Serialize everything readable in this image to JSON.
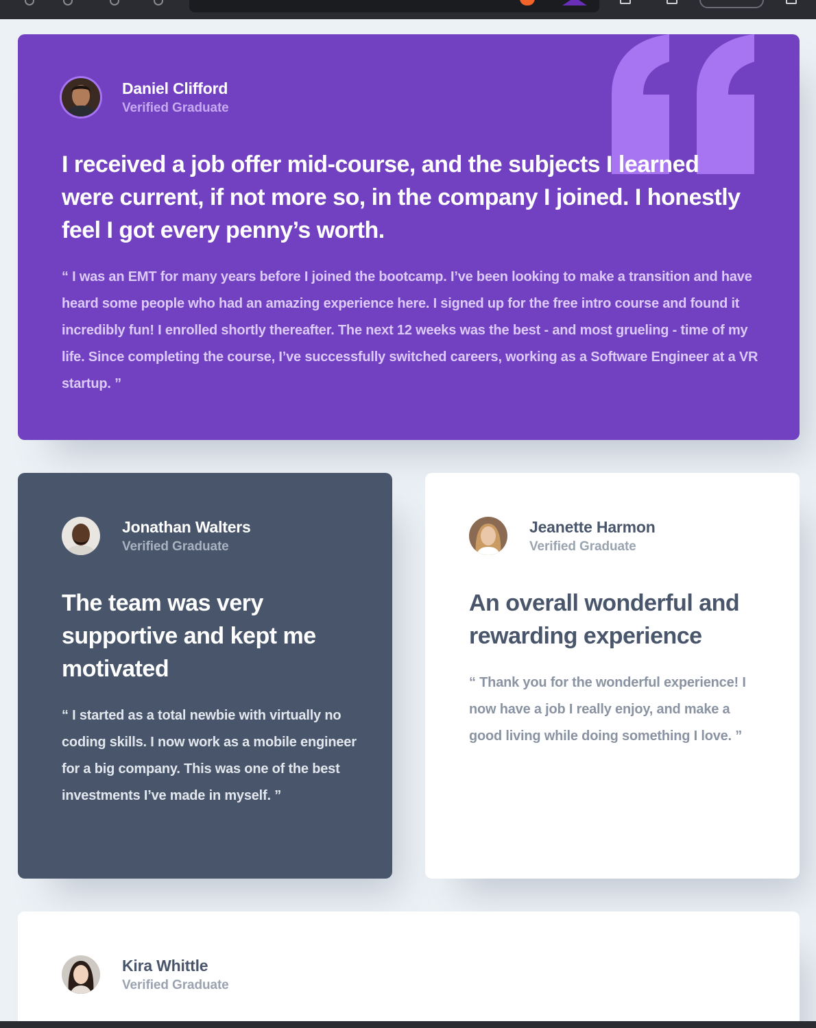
{
  "colors": {
    "purple": "#7241c1",
    "dark_blue": "#48556a",
    "white": "#ffffff",
    "page_bg": "#ecf1f6"
  },
  "testimonials": [
    {
      "name": "Daniel Clifford",
      "role": "Verified Graduate",
      "headline": "I received a job offer mid-course, and the subjects I learned were current, if not more so, in the company I joined. I honestly feel I got every penny’s worth.",
      "body": "“ I was an EMT for many years before I joined the bootcamp. I’ve been looking to make a transition and have heard some people who had an amazing experience here. I signed up for the free intro course and found it incredibly fun! I enrolled shortly thereafter. The next 12 weeks was the best - and most grueling - time of my life. Since completing the course, I’ve successfully switched careers, working as a Software Engineer at a VR startup. ”",
      "icon": "quote-mark-icon"
    },
    {
      "name": "Jonathan Walters",
      "role": "Verified Graduate",
      "headline": "The team was very supportive and kept me motivated",
      "body": "“ I started as a total newbie with virtually no coding skills. I now work as a mobile engineer for a big company. This was one of the best investments I’ve made in myself. ”"
    },
    {
      "name": "Jeanette Harmon",
      "role": "Verified Graduate",
      "headline": "An overall wonderful and rewarding experience",
      "body": "“ Thank you for the wonderful experience! I now have a job I really enjoy, and make a good living while doing something I love. ”"
    },
    {
      "name": "Kira Whittle",
      "role": "Verified Graduate"
    }
  ]
}
